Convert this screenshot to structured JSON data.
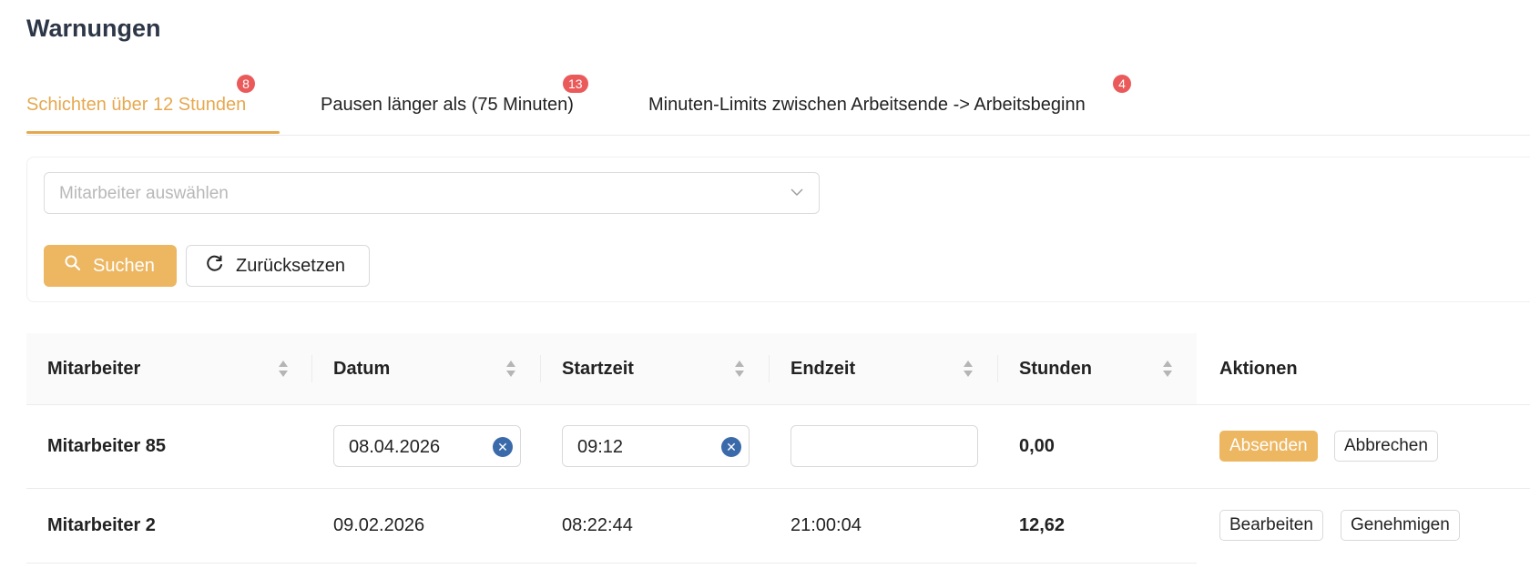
{
  "page": {
    "title": "Warnungen"
  },
  "tabs": [
    {
      "label": "Schichten über 12 Stunden",
      "badge": "8"
    },
    {
      "label": "Pausen länger als (75 Minuten)",
      "badge": "13"
    },
    {
      "label": "Minuten-Limits zwischen Arbeitsende -> Arbeitsbeginn",
      "badge": "4"
    }
  ],
  "filter": {
    "employee_select": {
      "placeholder": "Mitarbeiter auswählen",
      "icon": "chevron-down-icon"
    },
    "search_button": {
      "label": "Suchen",
      "icon": "search-icon"
    },
    "reset_button": {
      "label": "Zurücksetzen",
      "icon": "reset-icon"
    }
  },
  "table": {
    "columns": [
      "Mitarbeiter",
      "Datum",
      "Startzeit",
      "Endzeit",
      "Stunden",
      "Aktionen"
    ],
    "rows": [
      {
        "employee": "Mitarbeiter 85",
        "date": "08.04.2026",
        "start": "09:12",
        "end": "",
        "hours": "0,00",
        "actions": [
          "Absenden",
          "Abbrechen"
        ],
        "editing": true
      },
      {
        "employee": "Mitarbeiter 2",
        "date": "09.02.2026",
        "start": "08:22:44",
        "end": "21:00:04",
        "hours": "12,62",
        "actions": [
          "Bearbeiten",
          "Genehmigen"
        ],
        "editing": false
      }
    ]
  },
  "colors": {
    "accent": "#edb660",
    "badge": "#eb5a5a",
    "clear_icon": "#3a6aaa"
  }
}
